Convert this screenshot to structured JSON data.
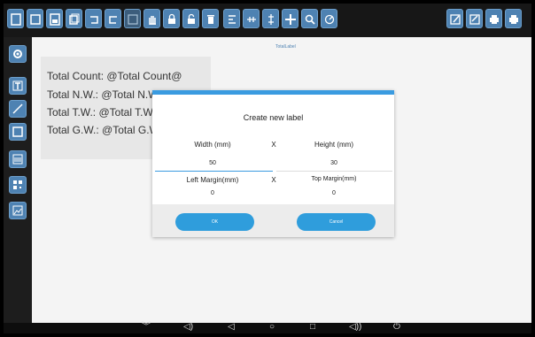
{
  "canvas": {
    "title": "TotalLabel"
  },
  "label_lines": [
    "Total Count: @Total Count@",
    "Total N.W.: @Total N.W.@ @Unit@",
    "Total T.W.: @Total T.W.",
    "Total G.W.: @Total G.W"
  ],
  "dialog": {
    "title": "Create new label",
    "width_label": "Width (mm)",
    "x_symbol": "X",
    "height_label": "Height (mm)",
    "width_value": "50",
    "height_value": "30",
    "left_margin_label": "Left Margin(mm)",
    "top_margin_label": "Top Margin(mm)",
    "left_margin_value": "0",
    "top_margin_value": "0",
    "ok_label": "OK",
    "cancel_label": "Cancel"
  },
  "toolbar_icons": [
    "new-file-icon",
    "page-icon",
    "save-icon",
    "copy-icon",
    "undo-icon",
    "redo-icon",
    "import-icon",
    "hand-icon",
    "lock-icon",
    "unlock-icon",
    "delete-icon",
    "align-left-icon",
    "align-horizontal-icon",
    "align-vertical-icon",
    "move-icon",
    "zoom-icon",
    "rotate-icon",
    "edit-icon",
    "edit-alt-icon",
    "print-icon",
    "print-alt-icon"
  ],
  "sidebar_icons": [
    "settings-icon",
    "text-icon",
    "line-icon",
    "rectangle-icon",
    "barcode-icon",
    "qrcode-icon",
    "image-icon"
  ],
  "navbar": {
    "down": "︾",
    "vol_down": "◁)",
    "back": "◁",
    "home": "○",
    "recents": "□",
    "vol_up": "◁))",
    "power": "⏻"
  },
  "colors": {
    "accent": "#3a9be0",
    "toolbar_button": "#4e82b2"
  }
}
